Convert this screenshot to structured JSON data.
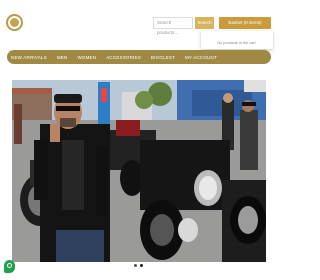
{
  "header": {
    "search_placeholder": "Search products…",
    "search_button": "Search",
    "basket_label": "Basket  (0 items)",
    "cart_empty": "No products in the cart."
  },
  "nav": {
    "items": [
      "NEW ARRIVALS",
      "MEN",
      "WOMEN",
      "ACCESSORIES",
      "BIGGLEST",
      "MY ACCOUNT"
    ]
  },
  "colors": {
    "accent": "#a08a43",
    "button": "#c99b3a",
    "chat": "#1fa34a"
  },
  "carousel": {
    "slide_count": 2,
    "active_slide": 1
  }
}
